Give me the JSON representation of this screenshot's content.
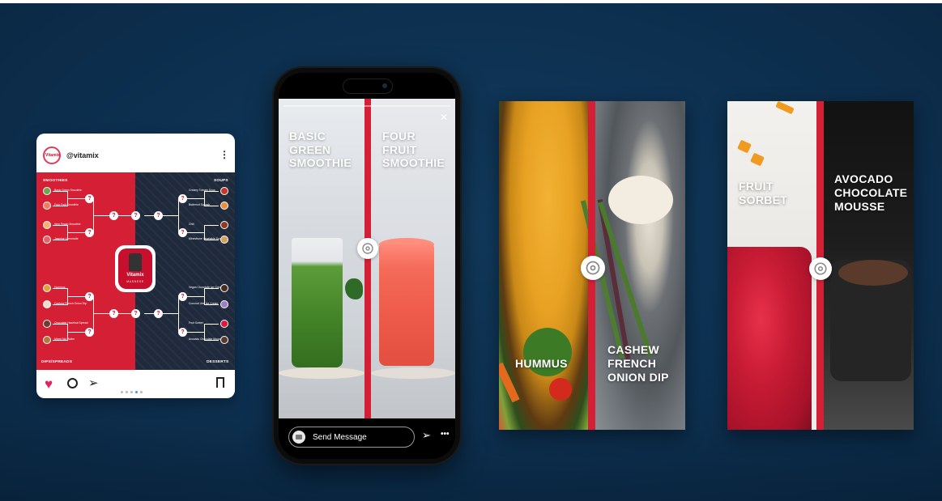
{
  "instagram_post": {
    "handle": "@vitamix",
    "avatar_text": "Vitamix",
    "more_glyph": "⋮",
    "bracket": {
      "top_left_label": "SMOOTHIES",
      "top_right_label": "SOUPS",
      "bottom_left_label": "DIPS/SPREADS",
      "bottom_right_label": "DESSERTS",
      "logo_text": "Vitamix",
      "logo_sub": "MADNESS",
      "question_mark": "?",
      "smoothies": [
        "Basic Green Smoothie",
        "Four Fruit Smoothie",
        "Very Peach Smoothie",
        "Jasmine Lemonade"
      ],
      "soups": [
        "Creamy Tomato Soup",
        "Butternut Squash",
        "Chili",
        "Minestrone Vegetable Soup"
      ],
      "dips": [
        "Hummus",
        "Cashew French Onion Dip",
        "Chocolate Hazelnut Spread",
        "Mixed Nut Butter"
      ],
      "desserts": [
        "Vegan Chocolate Ice Cream",
        "Coconut Ube Ice Cream",
        "Fruit Sorbet",
        "Avocado Chocolate Mousse"
      ]
    },
    "carousel_dots": 5,
    "active_dot": 3,
    "colors": {
      "red": "#d51f35",
      "navy": "#1f2a3c"
    }
  },
  "phone_story": {
    "left_title": [
      "BASIC",
      "GREEN",
      "SMOOTHIE"
    ],
    "right_title": [
      "FOUR",
      "FRUIT",
      "SMOOTHIE"
    ],
    "close_glyph": "✕",
    "reply_placeholder": "Send Message",
    "send_glyph": "➢",
    "more_glyph": "•••"
  },
  "story_cards": [
    {
      "left_title": [
        "HUMMUS"
      ],
      "right_title": [
        "CASHEW",
        "FRENCH",
        "ONION DIP"
      ]
    },
    {
      "left_title": [
        "FRUIT",
        "SORBET"
      ],
      "right_title": [
        "AVOCADO",
        "CHOCOLATE",
        "MOUSSE"
      ]
    }
  ],
  "icons": {
    "heart": "♥",
    "share": "➢"
  }
}
